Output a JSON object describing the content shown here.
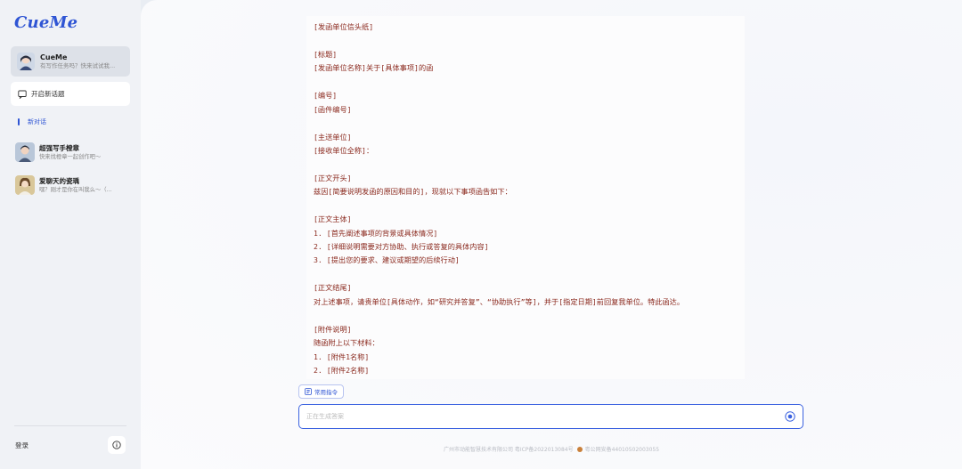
{
  "sidebar": {
    "logo": "CueMe",
    "current_assistant": {
      "name": "CueMe",
      "subtitle": "有写作任务吗？快来试试我..."
    },
    "new_topic_label": "开启新话题",
    "section_label": "新对话",
    "conversations": [
      {
        "title": "超强写手橙章",
        "subtitle": "快来找橙章一起创作吧～"
      },
      {
        "title": "爱聊天的瓷瑀",
        "subtitle": "嘿？刚才是你在叫我么～（..."
      }
    ],
    "login_label": "登录",
    "info_icon": "info-icon"
  },
  "document": {
    "lines": [
      "[发函单位信头纸]",
      "",
      "[标题]",
      "[发函单位名称]关于[具体事项]的函",
      "",
      "[编号]",
      "[函件编号]",
      "",
      "[主送单位]",
      "[接收单位全称]：",
      "",
      "[正文开头]",
      "兹因[简要说明发函的原因和目的]，现就以下事项函告如下：",
      "",
      "[正文主体]",
      "1. [首先阐述事项的背景或具体情况]",
      "2. [详细说明需要对方协助、执行或答复的具体内容]",
      "3. [提出您的要求、建议或期望的后续行动]",
      "",
      "[正文结尾]",
      "对上述事项，请贵单位[具体动作，如“研究并答复”、“协助执行”等]，并于[指定日期]前回复我单位。特此函达。",
      "",
      "[附件说明]",
      "随函附上以下材料：",
      "1. [附件1名称]",
      "2. [附件2名称]"
    ]
  },
  "toolbar": {
    "common_commands_label": "常用指令"
  },
  "input": {
    "placeholder": "正在生成答案"
  },
  "footer": {
    "icp": "广州市动能智慧技术有限公司 粤ICP备2022013084号",
    "police": "粤公网安备44010502003055"
  }
}
